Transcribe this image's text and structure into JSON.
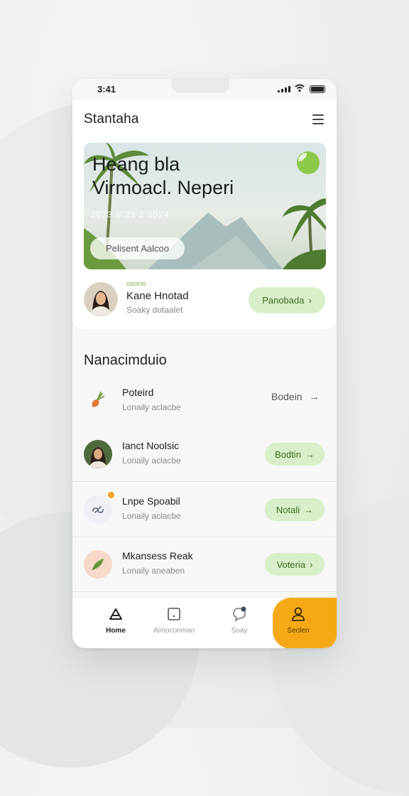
{
  "status_bar": {
    "time": "3:41"
  },
  "app": {
    "title": "Stantaha"
  },
  "hero": {
    "title_line1": "Heang bla",
    "title_line2": "Virmoacl. Neperi",
    "subtitle": "2023 // 23 2 2024",
    "button_label": "Pelisent Aalcoo"
  },
  "profile": {
    "tag": "cocicio",
    "name": "Kane Hnotad",
    "subtitle": "Soaky dotaalet",
    "button_label": "Panobada"
  },
  "section": {
    "title": "Nanacimduio"
  },
  "list": [
    {
      "title": "Poteird",
      "subtitle": "Lonaily aclacbe",
      "action": "Bodein",
      "style": "plain",
      "icon": "carrot-icon"
    },
    {
      "title": "Ianct Noolsic",
      "subtitle": "Lonaily aclacbe",
      "action": "Bodtin",
      "style": "pill",
      "icon": "avatar"
    },
    {
      "title": "Lnpe Spoabil",
      "subtitle": "Lonaily aclacbe",
      "action": "Notali",
      "style": "pill",
      "icon": "link-icon"
    },
    {
      "title": "Mkansess Reak",
      "subtitle": "Lonaily aneaben",
      "action": "Voteria",
      "style": "pill",
      "icon": "leaf-icon"
    }
  ],
  "tabbar": {
    "items": [
      {
        "label": "Home",
        "icon": "home-icon"
      },
      {
        "label": "Almoconman",
        "icon": "square-icon"
      },
      {
        "label": "Soay",
        "icon": "chat-icon"
      },
      {
        "label": "Seolen",
        "icon": "user-icon"
      }
    ]
  },
  "colors": {
    "accent_green": "#d8efc9",
    "accent_orange": "#f5a915",
    "badge_green": "#8dc94a"
  }
}
